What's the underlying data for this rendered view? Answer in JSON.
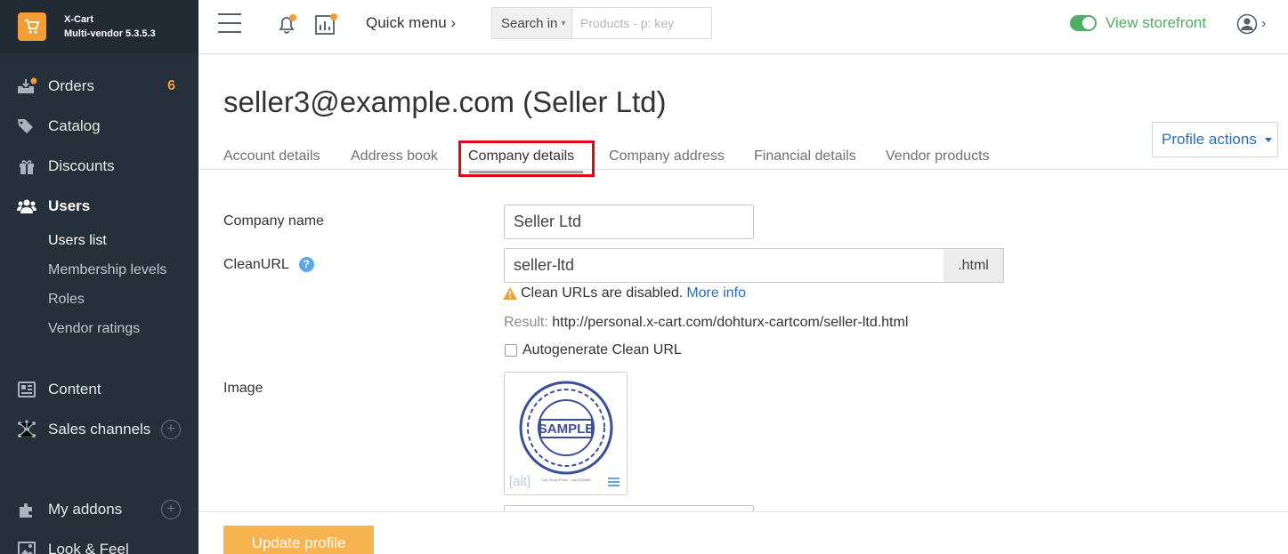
{
  "brand": {
    "name": "X-Cart",
    "version": "Multi-vendor 5.3.5.3"
  },
  "sidebar": {
    "items": [
      {
        "label": "Orders",
        "icon": "orders-icon",
        "badge": "6"
      },
      {
        "label": "Catalog",
        "icon": "tag-icon"
      },
      {
        "label": "Discounts",
        "icon": "gift-icon"
      },
      {
        "label": "Users",
        "icon": "users-icon",
        "active": true
      },
      {
        "label": "Content",
        "icon": "content-icon"
      },
      {
        "label": "Sales channels",
        "icon": "network-icon",
        "add": true
      },
      {
        "label": "My addons",
        "icon": "puzzle-icon",
        "add": true
      },
      {
        "label": "Look & Feel",
        "icon": "image-icon"
      }
    ],
    "users_sub": [
      "Users list",
      "Membership levels",
      "Roles",
      "Vendor ratings"
    ],
    "active_sub": "Users list"
  },
  "topbar": {
    "quick_menu": "Quick menu",
    "search_in": "Search in",
    "search_placeholder": "Products - p: key",
    "storefront": "View storefront"
  },
  "page": {
    "title": "seller3@example.com (Seller Ltd)",
    "profile_actions": "Profile actions",
    "tabs": [
      "Account details",
      "Address book",
      "Company details",
      "Company address",
      "Financial details",
      "Vendor products"
    ],
    "active_tab": "Company details"
  },
  "form": {
    "company_name_label": "Company name",
    "company_name": "Seller Ltd",
    "clean_url_label": "CleanURL",
    "clean_url": "seller-ltd",
    "clean_url_suffix": ".html",
    "warning": "Clean URLs are disabled.",
    "more_info": "More info",
    "result_label": "Result:",
    "result_url": "http://personal.x-cart.com/dohturx-cartcom/seller-ltd.html",
    "autogen_label": "Autogenerate Clean URL",
    "image_label": "Image",
    "image_alt": "[alt]",
    "image_stamp_text": "SAMPLE",
    "image_caption": "Can Stock Photo - csp7425480"
  },
  "footer": {
    "update_button": "Update profile"
  },
  "colors": {
    "sidebar_bg": "#26303a",
    "accent": "#f29d38",
    "link": "#2a6ebb",
    "green": "#4fae61",
    "highlight": "#e30613"
  }
}
